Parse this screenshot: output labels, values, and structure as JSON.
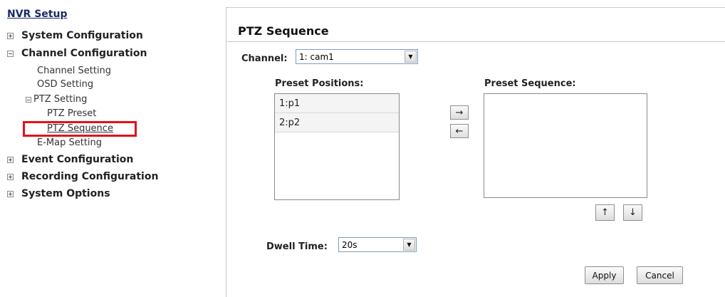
{
  "sidebar": {
    "title": "NVR Setup",
    "categories": [
      {
        "label": "System Configuration",
        "expander": "+"
      },
      {
        "label": "Channel Configuration",
        "expander": "−"
      },
      {
        "label": "Event Configuration",
        "expander": "+"
      },
      {
        "label": "Recording Configuration",
        "expander": "+"
      },
      {
        "label": "System Options",
        "expander": "+"
      }
    ],
    "channel_items": {
      "channel_setting": "Channel Setting",
      "osd_setting": "OSD Setting",
      "ptz_setting": "PTZ Setting",
      "ptz_preset": "PTZ Preset",
      "ptz_sequence": "PTZ Sequence",
      "emap_setting": "E-Map Setting"
    },
    "highlight_color": "#e0121b"
  },
  "main": {
    "title": "PTZ Sequence",
    "channel": {
      "label": "Channel:",
      "value": "1: cam1"
    },
    "preset_positions": {
      "label": "Preset Positions:",
      "items": [
        "1:p1",
        "2:p2"
      ]
    },
    "preset_sequence": {
      "label": "Preset Sequence:",
      "items": []
    },
    "move_right_icon": "right-arrow-icon",
    "move_left_icon": "left-arrow-icon",
    "move_up_icon": "up-arrow-icon",
    "move_down_icon": "down-arrow-icon",
    "dwell_time": {
      "label": "Dwell Time:",
      "value": "20s"
    },
    "apply_label": "Apply",
    "cancel_label": "Cancel"
  }
}
